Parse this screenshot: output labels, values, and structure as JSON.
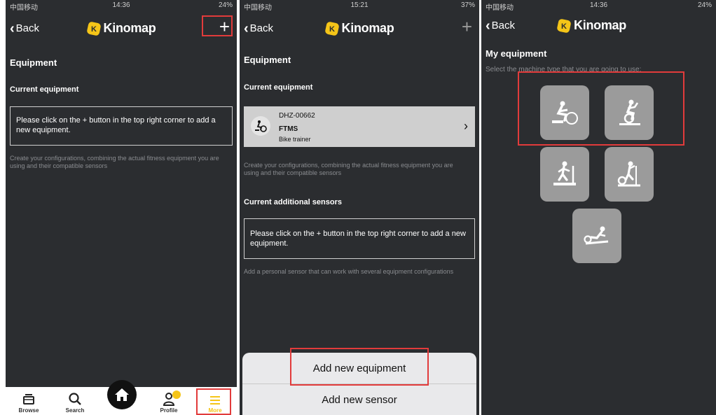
{
  "status_bars": [
    {
      "carrier": "中国移动",
      "time": "14:36",
      "battery": "24%"
    },
    {
      "carrier": "中国移动",
      "time": "15:21",
      "battery": "37%"
    },
    {
      "carrier": "中国移动",
      "time": "14:36",
      "battery": "24%"
    }
  ],
  "nav": {
    "back_label": "Back",
    "app_name": "Kinomap",
    "add_symbol": "+"
  },
  "screen1": {
    "title": "Equipment",
    "current_equipment_label": "Current equipment",
    "notice": "Please click on the + button in the top right corner to add a new equipment.",
    "hint": "Create your configurations, combining the actual fitness equipment you are using and their compatible sensors",
    "tabs": [
      {
        "label": "Browse",
        "icon": "tray-icon"
      },
      {
        "label": "Search",
        "icon": "search-icon"
      },
      {
        "label": "Profile",
        "icon": "user-icon"
      },
      {
        "label": "More",
        "icon": "menu-icon"
      }
    ],
    "highlight_color": "#e23b3b",
    "more_color": "#f5c518"
  },
  "screen2": {
    "title": "Equipment",
    "current_equipment_label": "Current equipment",
    "equipment": {
      "id": "DHZ-00662",
      "protocol": "FTMS",
      "type": "Bike trainer"
    },
    "hint": "Create your configurations, combining the actual fitness equipment you are using and their compatible sensors",
    "additional_sensors_label": "Current additional sensors",
    "notice": "Please click on the + button in the top right corner to add a new equipment.",
    "sensor_hint": "Add a personal sensor that can work with several equipment configurations",
    "sheet_options": [
      "Add new equipment",
      "Add new sensor"
    ]
  },
  "screen3": {
    "title": "My equipment",
    "instruction": "Select the machine type that you are going to use:",
    "machines": [
      "bike-trainer-icon",
      "exercise-bike-icon",
      "treadmill-icon",
      "elliptical-icon",
      "rower-icon"
    ]
  }
}
